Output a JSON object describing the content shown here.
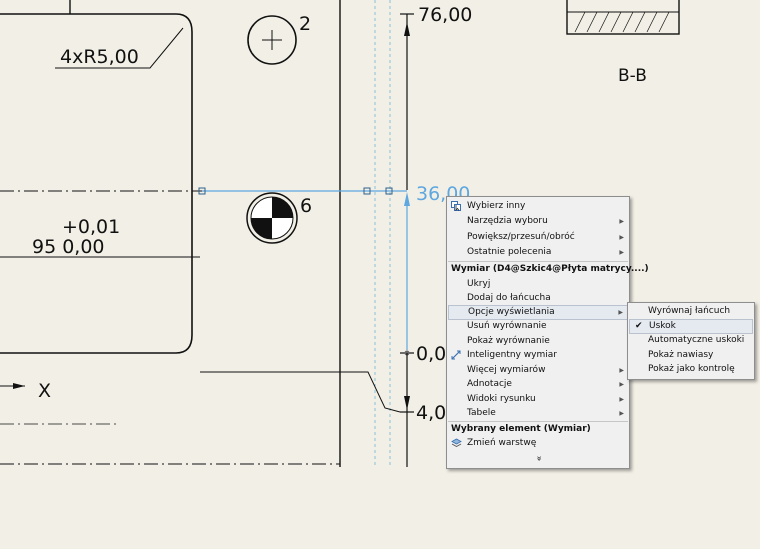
{
  "drawing": {
    "dims": {
      "d76": "76,00",
      "d36": "36,00",
      "d0": "0,0",
      "d4": "4,0",
      "radius": "4xR5,00",
      "tol_upper": "+0,01",
      "tol_main": "95  0,00",
      "hole2": "2",
      "hole6": "6",
      "section": "B-B",
      "axis_x": "X"
    }
  },
  "context_menu": {
    "items": {
      "select_other": "Wybierz inny",
      "select_tools": "Narzędzia wyboru",
      "zoom_pan": "Powiększ/przesuń/obróć",
      "recent": "Ostatnie polecenia",
      "header_dim": "Wymiar (D4@Szkic4@Płyta matrycy....)",
      "hide": "Ukryj",
      "add_chain": "Dodaj do łańcucha",
      "display_options": "Opcje wyświetlania",
      "remove_align": "Usuń wyrównanie",
      "show_align": "Pokaż wyrównanie",
      "smart_dim": "Inteligentny wymiar",
      "more_dims": "Więcej wymiarów",
      "annotations": "Adnotacje",
      "drawing_views": "Widoki rysunku",
      "tables": "Tabele",
      "header_selected": "Wybrany element (Wymiar)",
      "change_layer": "Zmień warstwę",
      "more": "»"
    }
  },
  "submenu": {
    "items": {
      "align_chain": "Wyrównaj łańcuch",
      "jog": "Uskok",
      "auto_jog": "Automatyczne uskoki",
      "show_brackets": "Pokaż nawiasy",
      "show_inspection": "Pokaż jako kontrolę"
    },
    "checked": "Uskok"
  }
}
